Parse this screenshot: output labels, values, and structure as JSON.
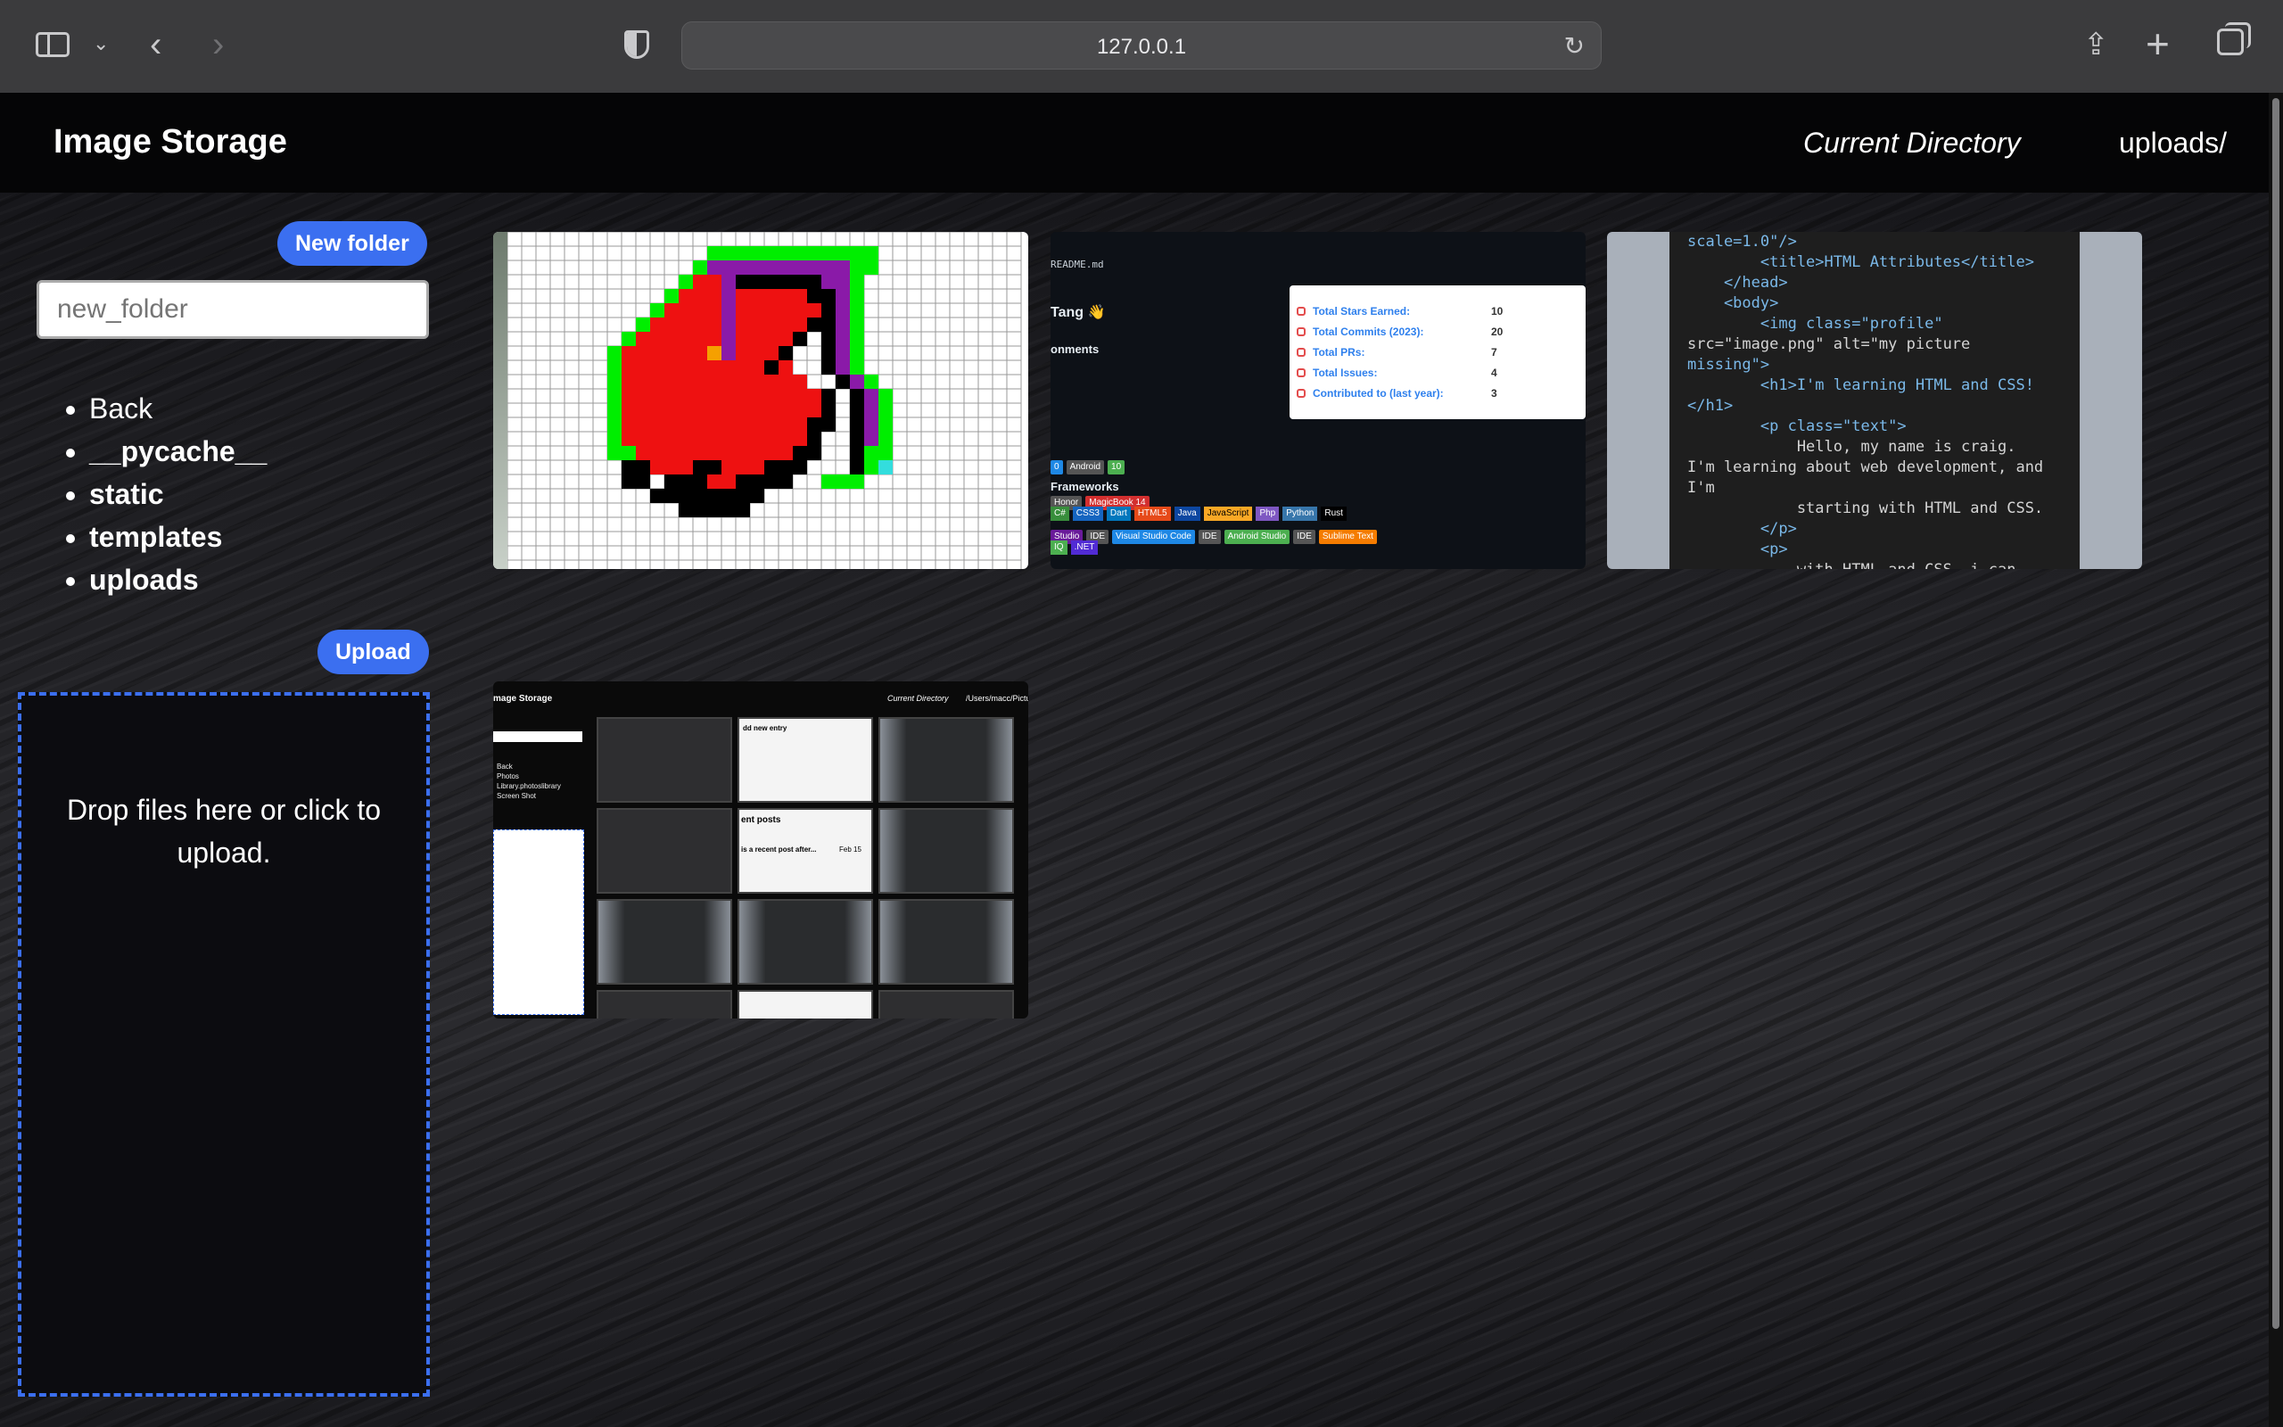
{
  "browser": {
    "url": "127.0.0.1"
  },
  "header": {
    "title": "Image Storage",
    "current_directory_label": "Current Directory",
    "current_directory_value": "uploads/"
  },
  "sidebar": {
    "new_folder_button": "New folder",
    "new_folder_placeholder": "new_folder",
    "folders": [
      "Back",
      "__pycache__",
      "static",
      "templates",
      "uploads"
    ],
    "upload_button": "Upload",
    "dropzone_text": "Drop files here or click to upload."
  },
  "thumbnails": {
    "readme": {
      "filename": "README.md",
      "greeting": "Tang 👋",
      "environments_heading": "onments",
      "frameworks_heading": "Frameworks",
      "stats": [
        {
          "label": "Total Stars Earned:",
          "value": "10"
        },
        {
          "label": "Total Commits (2023):",
          "value": "20"
        },
        {
          "label": "Total PRs:",
          "value": "7"
        },
        {
          "label": "Total Issues:",
          "value": "4"
        },
        {
          "label": "Contributed to (last year):",
          "value": "3"
        }
      ],
      "badges_row1": [
        "0",
        "Android",
        "10"
      ],
      "badges_row2": [
        "Honor",
        "MagicBook 14"
      ],
      "badges_row3": [
        "Studio",
        "IDE",
        "Visual Studio Code",
        "IDE",
        "Android Studio",
        "IDE",
        "Sublime Text"
      ],
      "badges_row4": [
        "C#",
        "CSS3",
        "Dart",
        "HTML5",
        "Java",
        "JavaScript",
        "Php",
        "Python",
        "Rust"
      ],
      "badges_row5": [
        "IQ",
        ".NET"
      ]
    },
    "code": {
      "lines": [
        "scale=1.0\"/>",
        "        <title>HTML Attributes</title>",
        "    </head>",
        "    <body>",
        "        <img class=\"profile\"",
        "src=\"image.png\" alt=\"my picture",
        "missing\">",
        "        <h1>I'm learning HTML and CSS!",
        "</h1>",
        "        <p class=\"text\">",
        "            Hello, my name is craig.",
        "I'm learning about web development, and",
        "I'm",
        "            starting with HTML and CSS.",
        "        </p>",
        "        <p>",
        "            with HTML and CSS, i can"
      ]
    },
    "app_screenshot": {
      "title": "mage Storage",
      "current_directory": "Current Directory",
      "path": "/Users/macc/Pictur",
      "list": [
        "Back",
        "Photos",
        "Library.photoslibrary",
        "Screen Shot"
      ],
      "entry_title": "dd new entry",
      "posts_title": "ent posts",
      "post_text": "is a recent post after...",
      "post_date": "Feb 15"
    }
  },
  "colors": {
    "accent": "#3b6ff0",
    "header_bg": "#050506"
  }
}
